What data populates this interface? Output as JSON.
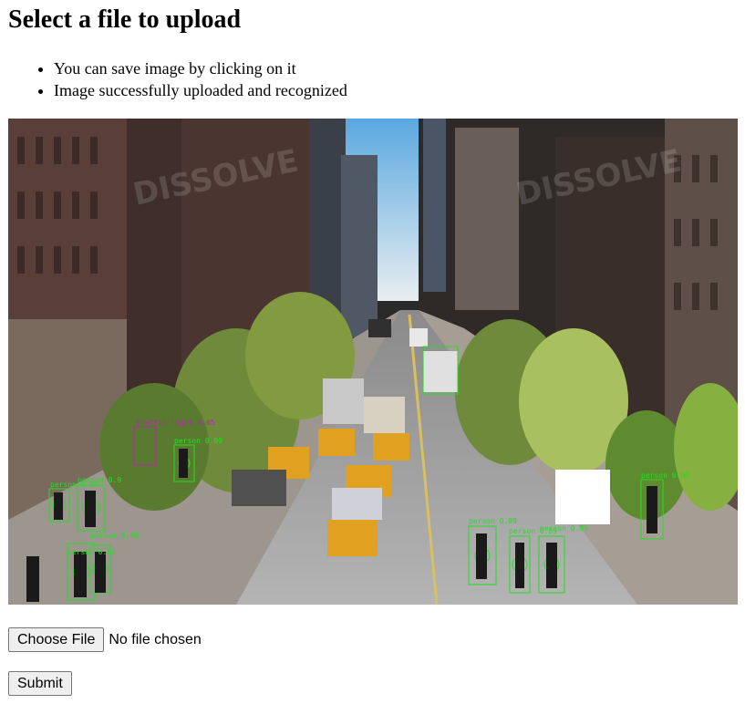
{
  "page": {
    "heading": "Select a file to upload",
    "messages": [
      "You can save image by clicking on it",
      "Image successfully uploaded and recognized"
    ]
  },
  "result_image": {
    "detections": [
      {
        "label": "traffic light",
        "score": "0.65",
        "color": "#c020c0"
      },
      {
        "label": "person",
        "score": "0.99",
        "color": "#20e020"
      },
      {
        "label": "person",
        "score": "0.97",
        "color": "#20e020"
      },
      {
        "label": "person",
        "score": "0.9",
        "color": "#20e020"
      },
      {
        "label": "person",
        "score": "0.89",
        "color": "#20e020"
      },
      {
        "label": "person",
        "score": "0.88",
        "color": "#20e020"
      },
      {
        "label": "person",
        "score": "0.89",
        "color": "#20e020"
      },
      {
        "label": "person",
        "score": "0.89",
        "color": "#20e020"
      },
      {
        "label": "person",
        "score": "0.89",
        "color": "#20e020"
      },
      {
        "label": "person",
        "score": "0.92",
        "color": "#20e020"
      }
    ],
    "watermark": "DISSOLVE"
  },
  "upload": {
    "choose_label": "Choose File",
    "status": "No file chosen",
    "submit_label": "Submit"
  }
}
